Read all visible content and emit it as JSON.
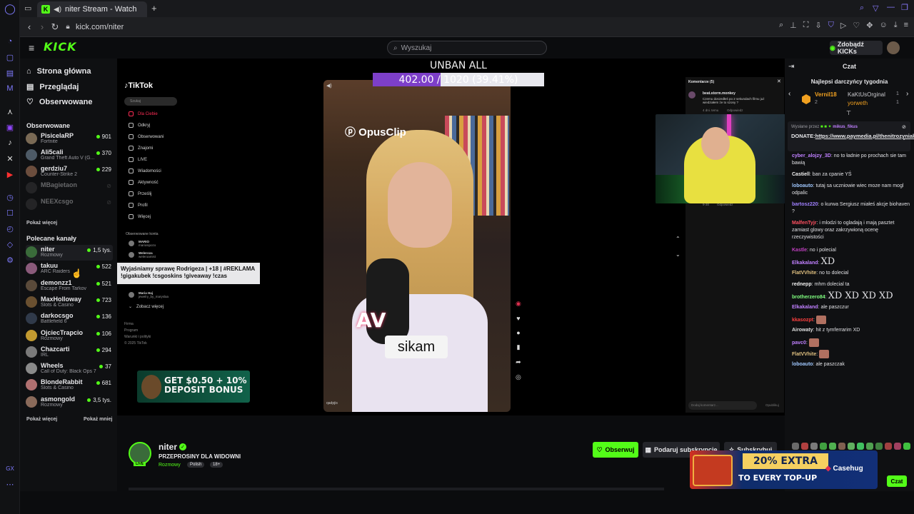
{
  "browser": {
    "tab_title": "niter Stream - Watch l",
    "url": "kick.com/niter",
    "new_tab": "+"
  },
  "header": {
    "logo": "KICK",
    "search_placeholder": "Wyszukaj",
    "get_kicks": "Zdobądź KICKs"
  },
  "sidebar": {
    "nav": [
      {
        "label": "Strona główna",
        "icon": "home-icon"
      },
      {
        "label": "Przeglądaj",
        "icon": "browse-icon"
      },
      {
        "label": "Obserwowane",
        "icon": "heart-icon"
      }
    ],
    "followed_title": "Obserwowane",
    "followed": [
      {
        "name": "PisicelaRP",
        "category": "Fortnite",
        "viewers": "901",
        "online": true,
        "color": "#7a6a55"
      },
      {
        "name": "Ali5cali",
        "category": "Grand Theft Auto V (G...",
        "viewers": "370",
        "online": true,
        "color": "#4d5a66"
      },
      {
        "name": "gerdziu7",
        "category": "Counter-Strike 2",
        "viewers": "229",
        "online": true,
        "color": "#6b4d3d"
      },
      {
        "name": "MBagietaon",
        "category": "",
        "viewers": "",
        "online": false,
        "color": "#444"
      },
      {
        "name": "NEEXcsgo",
        "category": "",
        "viewers": "",
        "online": false,
        "color": "#444"
      }
    ],
    "show_more": "Pokaż więcej",
    "recommended_title": "Polecane kanały",
    "recommended": [
      {
        "name": "niter",
        "category": "Rozmowy",
        "viewers": "1,5 tys.",
        "color": "#3a6b3a"
      },
      {
        "name": "takuu",
        "category": "ARC Raiders",
        "viewers": "522",
        "color": "#8a5a7a"
      },
      {
        "name": "demonzz1",
        "category": "Escape From Tarkov",
        "viewers": "521",
        "color": "#5a4a3a"
      },
      {
        "name": "MaxHolloway",
        "category": "Slots & Casino",
        "viewers": "723",
        "color": "#6a5030"
      },
      {
        "name": "darkocsgo",
        "category": "Battlefield 6",
        "viewers": "136",
        "color": "#303a4a"
      },
      {
        "name": "OjciecTrapcio",
        "category": "Rozmowy",
        "viewers": "106",
        "color": "#c29a30"
      },
      {
        "name": "Chazcarti",
        "category": "IRL",
        "viewers": "294",
        "color": "#7a7a7a"
      },
      {
        "name": "Wheels",
        "category": "Call of Duty: Black Ops 7",
        "viewers": "37",
        "color": "#8a8a8a"
      },
      {
        "name": "BlondeRabbit",
        "category": "Slots & Casino",
        "viewers": "681",
        "color": "#b07070"
      },
      {
        "name": "asmongold",
        "category": "Rozmowy",
        "viewers": "3,5 tys.",
        "color": "#8a6a5a"
      }
    ],
    "show_more2": "Pokaż więcej",
    "show_less": "Pokaż mniej"
  },
  "video": {
    "goal_title": "UNBAN ALL",
    "goal_text": "402.00 / 1020 (39.41%)",
    "goal_progress": 0.3941,
    "tiktok_logo": "TikTok",
    "tiktok_search": "Szukaj",
    "tiktok_menu": [
      "Dla Ciebie",
      "Odkryj",
      "Obserwowani",
      "Znajomi",
      "LIVE",
      "Wiadomości",
      "Aktywność",
      "Prześlij",
      "Profil",
      "Więcej"
    ],
    "tiktok_followed_title": "Obserwowane konta",
    "tiktok_accounts": [
      {
        "name": "MARIO",
        "handle": "mariosipozo"
      },
      {
        "name": "Weleroza",
        "handle": "weleroamist"
      },
      {
        "name": "Maria Haj",
        "handle": "jewelry_by_maryslaa"
      }
    ],
    "tiktok_see_more": "Zobacz więcej",
    "tiktok_footer": [
      "Firma",
      "Program",
      "Warunki i polityki",
      "© 2025 TikTok"
    ],
    "opus": "OpusClip",
    "caption": "sikam",
    "phone_tag": "qadpjis",
    "comments_title": "Komentarze (5)",
    "comment_user": "beat.storm.monkey",
    "comment_text": "Czemu doszedłeś po 2 sekundach filmu już wiedziałem że to szony ?",
    "comment_meta": "4 dni. temu",
    "comment_reply": "Odpowiedz",
    "comment_time2": "9-30",
    "comment_reply2": "Odpowiedz",
    "comment_input": "Dodaj komentarz...",
    "comment_send": "Opublikuj",
    "banner_text": "GET $0.50 + 10% DEPOSIT BONUS",
    "tooltip": "Wyjaśniamy sprawę Rodrigeza | +18 | #REKLAMA !gigakubek !csgoskins !giveaway !czas"
  },
  "channel": {
    "name": "niter",
    "title": "PRZEPROSINY DLA WIDOWNI",
    "category": "Rozmowy",
    "tags": [
      "Polish",
      "18+"
    ],
    "live": "LIVE",
    "follow": "Obserwuj",
    "gift_sub": "Podaruj subskrypcję",
    "subscribe": "Subskrybuj"
  },
  "chat": {
    "title": "Czat",
    "gifters_title": "Najlepsi darczyńcy tygodnia",
    "gifters": [
      {
        "name": "Vernil18",
        "count": "2",
        "color": "#f0a020"
      },
      {
        "name": "KaKtUsOrginal",
        "count": "1",
        "color": "#c8c8cc"
      },
      {
        "name": "yorweth",
        "count": "1",
        "color": "#f0a020"
      }
    ],
    "pinned_by": "Wysłane przez",
    "pinned_user": "mikus_fikus",
    "pinned_text": "DONATE:",
    "pinned_link": "https://www.paymedia.pl/thenitrozyniak",
    "messages": [
      {
        "user": "cyber_alojzy_3D",
        "text": "no to ładnie po prochach sie tam bawią",
        "color": "#c080ff"
      },
      {
        "user": "Castiell",
        "text": "ban za cpanie YŚ",
        "color": "#f0f0f0"
      },
      {
        "user": "loboauto",
        "text": "tutaj sa uczniowie wiec moze nam mogl odpalic",
        "color": "#a0c8ff"
      },
      {
        "user": "bartosz220",
        "text": "o kurwa Sergiusz miałeś akcje biohaven ?",
        "color": "#a080ff"
      },
      {
        "user": "MalfenTyjr",
        "text": "i mlodzi to ogladają i mają pasztet zamiast glowy oraz zakrzywioną ocenę rzeczywistości",
        "color": "#ff5060"
      },
      {
        "user": "Kastle",
        "text": "no i polecial",
        "color": "#c040c0"
      },
      {
        "user": "Elkakaland",
        "text": "XD",
        "color": "#c080ff"
      },
      {
        "user": "FlatVVhite",
        "text": "no to dolecial",
        "color": "#e0c080"
      },
      {
        "user": "rednepp",
        "text": "mhm dolecial ta",
        "color": "#f0f0f0"
      },
      {
        "user": "brotherzero84",
        "text": "XD XD XD XD",
        "color": "#80ff80"
      },
      {
        "user": "Elkakaland",
        "text": "ale paszczur",
        "color": "#c080ff"
      },
      {
        "user": "kkasozpt",
        "text": "",
        "color": "#ff4040"
      },
      {
        "user": "Airowaty",
        "text": "hit z tymferrarim XD",
        "color": "#e0e0e0"
      },
      {
        "user": "pavc0",
        "text": "",
        "color": "#c080ff"
      },
      {
        "user": "FlatVVhite",
        "text": "",
        "color": "#e0c080"
      },
      {
        "user": "loboauto",
        "text": "ale paszczak",
        "color": "#a0c8ff"
      }
    ],
    "send": "Czat",
    "ad_text": "20% EXTRA",
    "ad_sub": "TO EVERY TOP-UP",
    "ad_brand": "Casehug"
  },
  "colors": {
    "kick_green": "#53fc18",
    "goal_purple": "#7d3fc9"
  }
}
